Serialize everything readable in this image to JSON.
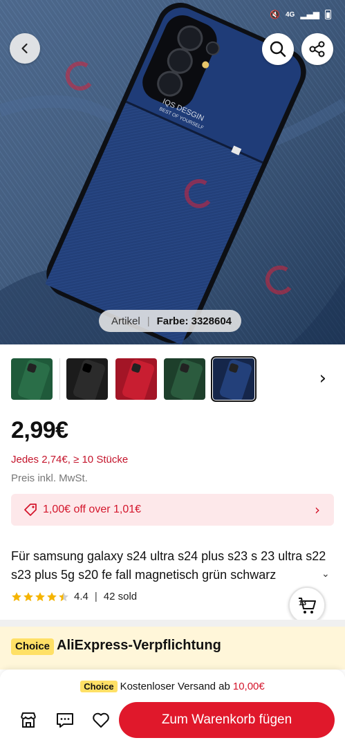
{
  "status_bar": {
    "network": "4G",
    "mute_icon": "mute-icon",
    "signal_icon": "signal-icon",
    "battery_icon": "battery-icon"
  },
  "hero": {
    "media_tabs": [
      "Artikel",
      "Farbe: 3328604"
    ],
    "active_tab": "Farbe: 3328604",
    "case_print_line1": "IQS DESGIN",
    "case_print_line2": "BEST OF YOURSELF"
  },
  "thumbnails": [
    {
      "name": "green",
      "color": "#1f5a3a"
    },
    {
      "name": "black",
      "color": "#1b1b1b"
    },
    {
      "name": "red",
      "color": "#b81a2c"
    },
    {
      "name": "green-2",
      "color": "#234c34"
    },
    {
      "name": "blue",
      "color": "#1d3a6e",
      "selected": true
    }
  ],
  "price": {
    "main": "2,99€",
    "bulk": "Jedes 2,74€, ≥ 10 Stücke",
    "tax_note": "Preis inkl. MwSt."
  },
  "coupon": {
    "text": "1,00€ off over 1,01€"
  },
  "product": {
    "title": "Für samsung galaxy s24 ultra s24 plus s23 s 23 ultra s22 s23 plus 5g s20 fe fall magnetisch grün schwarz",
    "rating": "4.4",
    "rating_value": 4.4,
    "sold": "42 sold",
    "cart_count": "13"
  },
  "choice": {
    "badge": "Choice",
    "title": "AliExpress-Verpflichtung"
  },
  "bottom": {
    "ship_badge": "Choice",
    "ship_text": "Kostenloser Versand ab",
    "ship_amount": "10,00€",
    "add_to_cart": "Zum Warenkorb fügen"
  },
  "colors": {
    "brand_red": "#e0182b",
    "price_red": "#c4142b",
    "choice_yellow": "#ffe066",
    "coupon_bg": "#fde8ea",
    "star": "#f5b400"
  }
}
